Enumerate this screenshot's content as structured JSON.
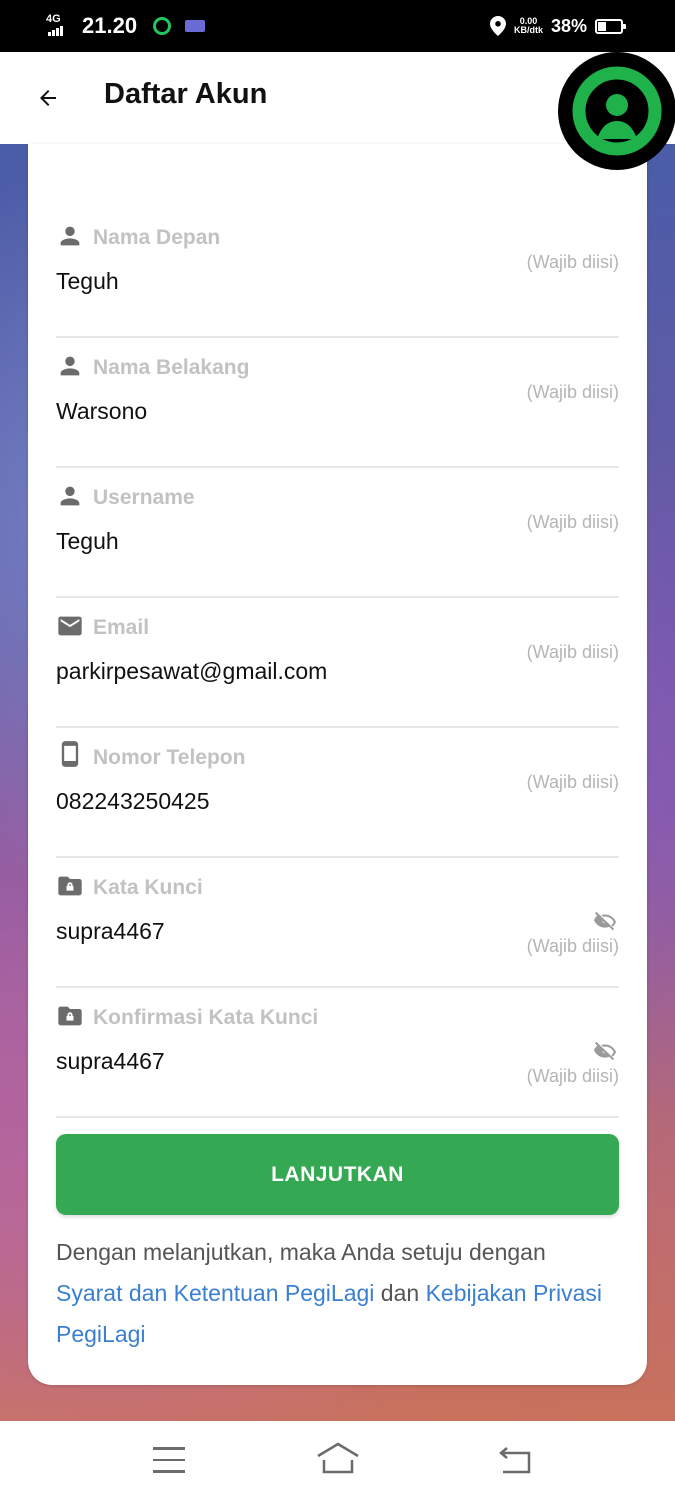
{
  "status_bar": {
    "network": "4G",
    "time": "21.20",
    "speed_value": "0.00",
    "speed_unit": "KB/dtk",
    "battery_percent": "38%",
    "battery_level": 0.38
  },
  "header": {
    "title": "Daftar Akun"
  },
  "form": {
    "required_text": "(Wajib diisi)",
    "fields": [
      {
        "icon": "person-icon",
        "label": "Nama Depan",
        "value": "Teguh"
      },
      {
        "icon": "person-icon",
        "label": "Nama Belakang",
        "value": "Warsono"
      },
      {
        "icon": "person-icon",
        "label": "Username",
        "value": "Teguh"
      },
      {
        "icon": "email-icon",
        "label": "Email",
        "value": "parkirpesawat@gmail.com"
      },
      {
        "icon": "phone-icon",
        "label": "Nomor Telepon",
        "value": "082243250425"
      },
      {
        "icon": "lock-folder-icon",
        "label": "Kata Kunci",
        "value": "supra4467"
      },
      {
        "icon": "lock-folder-icon",
        "label": "Konfirmasi Kata Kunci",
        "value": "supra4467"
      }
    ],
    "submit_label": "LANJUTKAN"
  },
  "terms": {
    "prefix": "Dengan melanjutkan, maka Anda setuju dengan ",
    "terms_link": "Syarat dan Ketentuan PegiLagi",
    "conjunction": " dan ",
    "privacy_link": "Kebijakan Privasi PegiLagi"
  },
  "colors": {
    "primary": "#34a853",
    "link": "#3a7fd0",
    "label": "#c2c2c2"
  }
}
